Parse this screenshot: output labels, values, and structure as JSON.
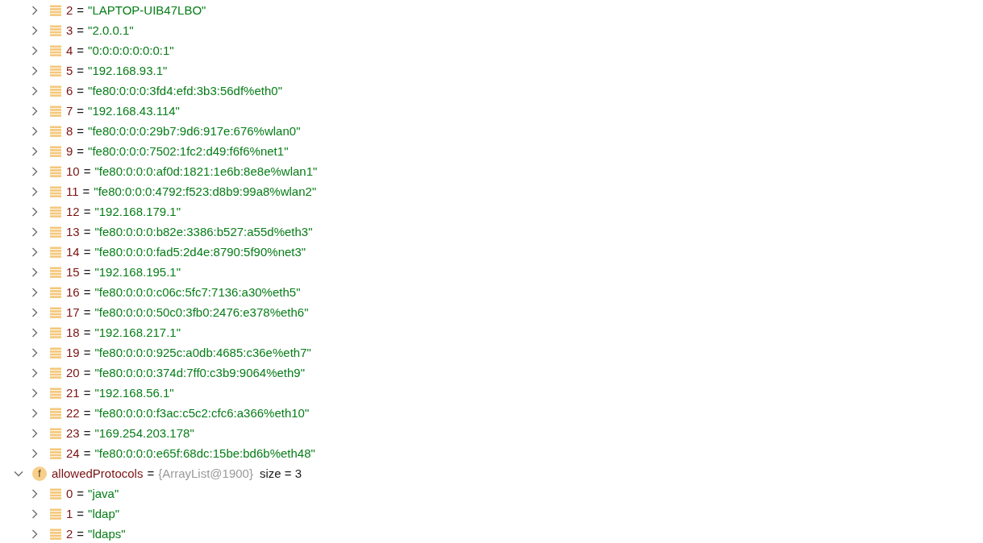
{
  "tree": [
    {
      "kind": "continued",
      "children": [
        {
          "kind": "element",
          "index": "2",
          "separator": "=",
          "value": "\"LAPTOP-UIB47LBO\"",
          "expanded": false
        },
        {
          "kind": "element",
          "index": "3",
          "separator": "=",
          "value": "\"2.0.0.1\"",
          "expanded": false
        },
        {
          "kind": "element",
          "index": "4",
          "separator": "=",
          "value": "\"0:0:0:0:0:0:0:1\"",
          "expanded": false
        },
        {
          "kind": "element",
          "index": "5",
          "separator": "=",
          "value": "\"192.168.93.1\"",
          "expanded": false
        },
        {
          "kind": "element",
          "index": "6",
          "separator": "=",
          "value": "\"fe80:0:0:0:3fd4:efd:3b3:56df%eth0\"",
          "expanded": false
        },
        {
          "kind": "element",
          "index": "7",
          "separator": "=",
          "value": "\"192.168.43.114\"",
          "expanded": false
        },
        {
          "kind": "element",
          "index": "8",
          "separator": "=",
          "value": "\"fe80:0:0:0:29b7:9d6:917e:676%wlan0\"",
          "expanded": false
        },
        {
          "kind": "element",
          "index": "9",
          "separator": "=",
          "value": "\"fe80:0:0:0:7502:1fc2:d49:f6f6%net1\"",
          "expanded": false
        },
        {
          "kind": "element",
          "index": "10",
          "separator": "=",
          "value": "\"fe80:0:0:0:af0d:1821:1e6b:8e8e%wlan1\"",
          "expanded": false
        },
        {
          "kind": "element",
          "index": "11",
          "separator": "=",
          "value": "\"fe80:0:0:0:4792:f523:d8b9:99a8%wlan2\"",
          "expanded": false
        },
        {
          "kind": "element",
          "index": "12",
          "separator": "=",
          "value": "\"192.168.179.1\"",
          "expanded": false
        },
        {
          "kind": "element",
          "index": "13",
          "separator": "=",
          "value": "\"fe80:0:0:0:b82e:3386:b527:a55d%eth3\"",
          "expanded": false
        },
        {
          "kind": "element",
          "index": "14",
          "separator": "=",
          "value": "\"fe80:0:0:0:fad5:2d4e:8790:5f90%net3\"",
          "expanded": false
        },
        {
          "kind": "element",
          "index": "15",
          "separator": "=",
          "value": "\"192.168.195.1\"",
          "expanded": false
        },
        {
          "kind": "element",
          "index": "16",
          "separator": "=",
          "value": "\"fe80:0:0:0:c06c:5fc7:7136:a30%eth5\"",
          "expanded": false
        },
        {
          "kind": "element",
          "index": "17",
          "separator": "=",
          "value": "\"fe80:0:0:0:50c0:3fb0:2476:e378%eth6\"",
          "expanded": false
        },
        {
          "kind": "element",
          "index": "18",
          "separator": "=",
          "value": "\"192.168.217.1\"",
          "expanded": false
        },
        {
          "kind": "element",
          "index": "19",
          "separator": "=",
          "value": "\"fe80:0:0:0:925c:a0db:4685:c36e%eth7\"",
          "expanded": false
        },
        {
          "kind": "element",
          "index": "20",
          "separator": "=",
          "value": "\"fe80:0:0:0:374d:7ff0:c3b9:9064%eth9\"",
          "expanded": false
        },
        {
          "kind": "element",
          "index": "21",
          "separator": "=",
          "value": "\"192.168.56.1\"",
          "expanded": false
        },
        {
          "kind": "element",
          "index": "22",
          "separator": "=",
          "value": "\"fe80:0:0:0:f3ac:c5c2:cfc6:a366%eth10\"",
          "expanded": false
        },
        {
          "kind": "element",
          "index": "23",
          "separator": "=",
          "value": "\"169.254.203.178\"",
          "expanded": false
        },
        {
          "kind": "element",
          "index": "24",
          "separator": "=",
          "value": "\"fe80:0:0:0:e65f:68dc:15be:bd6b%eth48\"",
          "expanded": false
        }
      ]
    },
    {
      "kind": "field",
      "icon": "f",
      "name": "allowedProtocols",
      "separator": "=",
      "type": "{ArrayList@1900}",
      "size": "size = 3",
      "expanded": true,
      "children": [
        {
          "kind": "element",
          "index": "0",
          "separator": "=",
          "value": "\"java\"",
          "expanded": false
        },
        {
          "kind": "element",
          "index": "1",
          "separator": "=",
          "value": "\"ldap\"",
          "expanded": false
        },
        {
          "kind": "element",
          "index": "2",
          "separator": "=",
          "value": "\"ldaps\"",
          "expanded": false
        }
      ]
    }
  ]
}
